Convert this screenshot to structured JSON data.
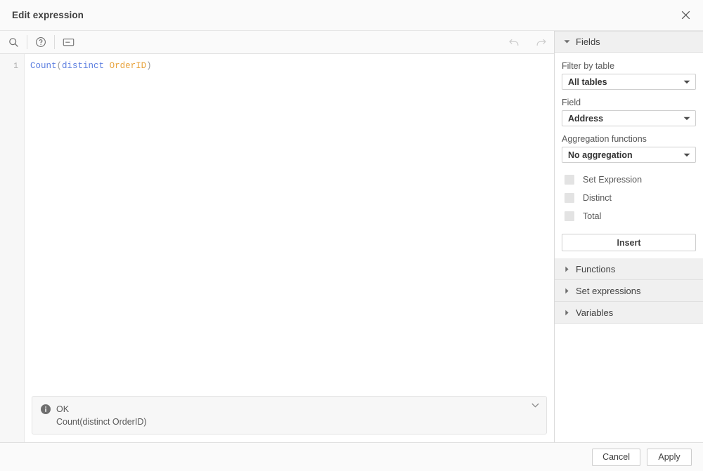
{
  "dialog": {
    "title": "Edit expression",
    "close_icon": "close-icon"
  },
  "toolbar": {
    "search_icon": "search-icon",
    "help_icon": "help-circle-icon",
    "comment_icon": "comment-icon",
    "undo_icon": "undo-arrow-icon",
    "redo_icon": "redo-arrow-icon"
  },
  "editor": {
    "line_number": "1",
    "tokens": {
      "func": "Count",
      "paren_open": "(",
      "keyword": "distinct",
      "space": " ",
      "field": "OrderID",
      "paren_close": ")"
    },
    "full_expression": "Count(distinct OrderID)"
  },
  "status": {
    "icon": "info-icon",
    "state": "OK",
    "preview": "Count(distinct OrderID)",
    "expand_icon": "chevron-down-icon"
  },
  "sidebar": {
    "sections": [
      {
        "label": "Fields",
        "expanded": true
      },
      {
        "label": "Functions",
        "expanded": false
      },
      {
        "label": "Set expressions",
        "expanded": false
      },
      {
        "label": "Variables",
        "expanded": false
      }
    ],
    "fields_panel": {
      "filter_by_table_label": "Filter by table",
      "filter_by_table_value": "All tables",
      "field_label": "Field",
      "field_value": "Address",
      "aggregation_label": "Aggregation functions",
      "aggregation_value": "No aggregation",
      "checkboxes": [
        {
          "label": "Set Expression",
          "checked": false
        },
        {
          "label": "Distinct",
          "checked": false
        },
        {
          "label": "Total",
          "checked": false
        }
      ],
      "insert_label": "Insert"
    }
  },
  "footer": {
    "cancel_label": "Cancel",
    "apply_label": "Apply"
  },
  "colors": {
    "token_function": "#5c7ee0",
    "token_keyword": "#5c7ee0",
    "token_field": "#e8a33d",
    "panel_header_bg": "#f0f0f0",
    "titlebar_bg": "#fafafa"
  }
}
